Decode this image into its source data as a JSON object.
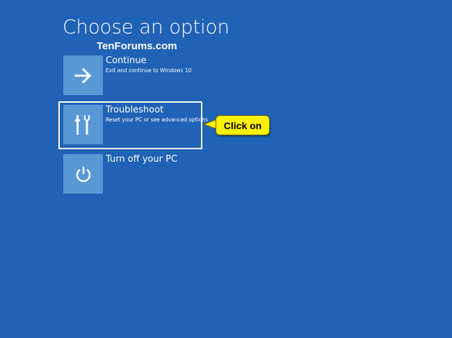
{
  "header": {
    "title": "Choose an option",
    "watermark": "TenForums.com"
  },
  "options": [
    {
      "label": "Continue",
      "description": "Exit and continue to Windows 10",
      "icon": "arrow-right-icon"
    },
    {
      "label": "Troubleshoot",
      "description": "Reset your PC or see advanced options",
      "icon": "tools-icon"
    },
    {
      "label": "Turn off your PC",
      "description": "",
      "icon": "power-icon"
    }
  ],
  "annotation": {
    "callout_text": "Click on"
  },
  "colors": {
    "background": "#2062b5",
    "tile": "#5898d6",
    "callout": "#fff200"
  }
}
